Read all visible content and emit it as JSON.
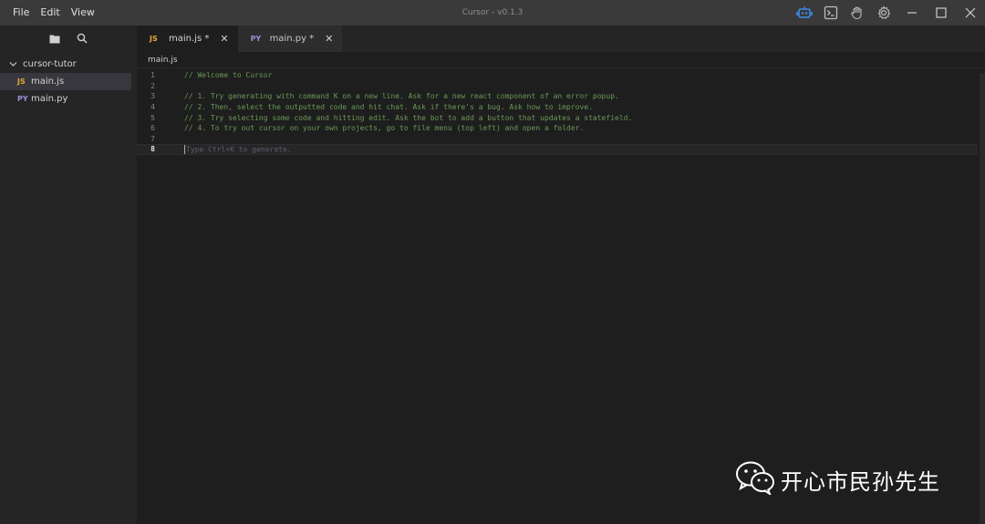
{
  "menu": {
    "file": "File",
    "edit": "Edit",
    "view": "View"
  },
  "window": {
    "title": "Cursor - v0.1.3"
  },
  "title_icons": [
    "robot-icon",
    "terminal-icon",
    "hand-icon",
    "gear-icon"
  ],
  "sidebar": {
    "folder": "cursor-tutor",
    "files": [
      {
        "badge": "JS",
        "name": "main.js"
      },
      {
        "badge": "PY",
        "name": "main.py"
      }
    ]
  },
  "tabs": [
    {
      "badge": "JS",
      "label": "main.js *"
    },
    {
      "badge": "PY",
      "label": "main.py *"
    }
  ],
  "breadcrumb": "main.js",
  "editor": {
    "lines": [
      {
        "n": "1",
        "text": "// Welcome to Cursor"
      },
      {
        "n": "2",
        "text": ""
      },
      {
        "n": "3",
        "text": "// 1. Try generating with command K on a new line. Ask for a new react component of an error popup."
      },
      {
        "n": "4",
        "text": "// 2. Then, select the outputted code and hit chat. Ask if there's a bug. Ask how to improve."
      },
      {
        "n": "5",
        "text": "// 3. Try selecting some code and hitting edit. Ask the bot to add a button that updates a statefield."
      },
      {
        "n": "6",
        "text": "// 4. To try out cursor on your own projects, go to file menu (top left) and open a folder."
      },
      {
        "n": "7",
        "text": ""
      },
      {
        "n": "8",
        "text": ""
      }
    ],
    "placeholder": "Type Ctrl+K to generate."
  },
  "watermark": "开心市民孙先生",
  "colors": {
    "accent": "#3b8eea",
    "comment": "#6a9955",
    "js_badge": "#e5a63a",
    "py_badge": "#9a8fd8"
  }
}
